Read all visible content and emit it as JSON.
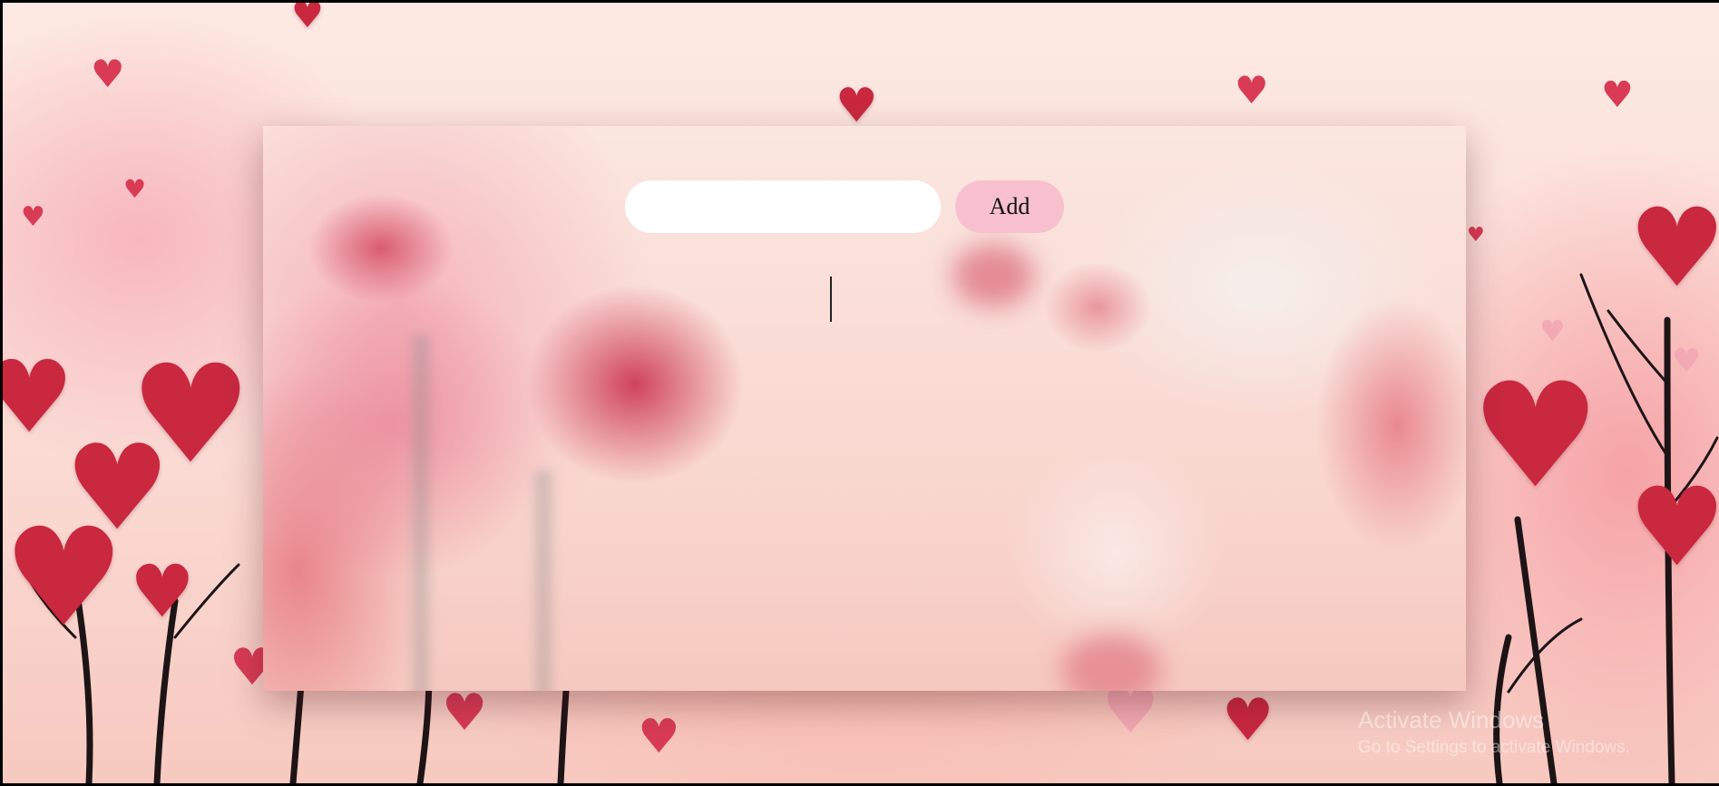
{
  "form": {
    "input_value": "",
    "input_placeholder": "",
    "add_label": "Add"
  },
  "watermark": {
    "title": "Activate Windows",
    "subtitle": "Go to Settings to activate Windows."
  },
  "icons": {
    "heart": "heart-icon"
  },
  "colors": {
    "add_button": "#f8c0ce",
    "heart": "#d93b55",
    "input": "#ffffff"
  }
}
